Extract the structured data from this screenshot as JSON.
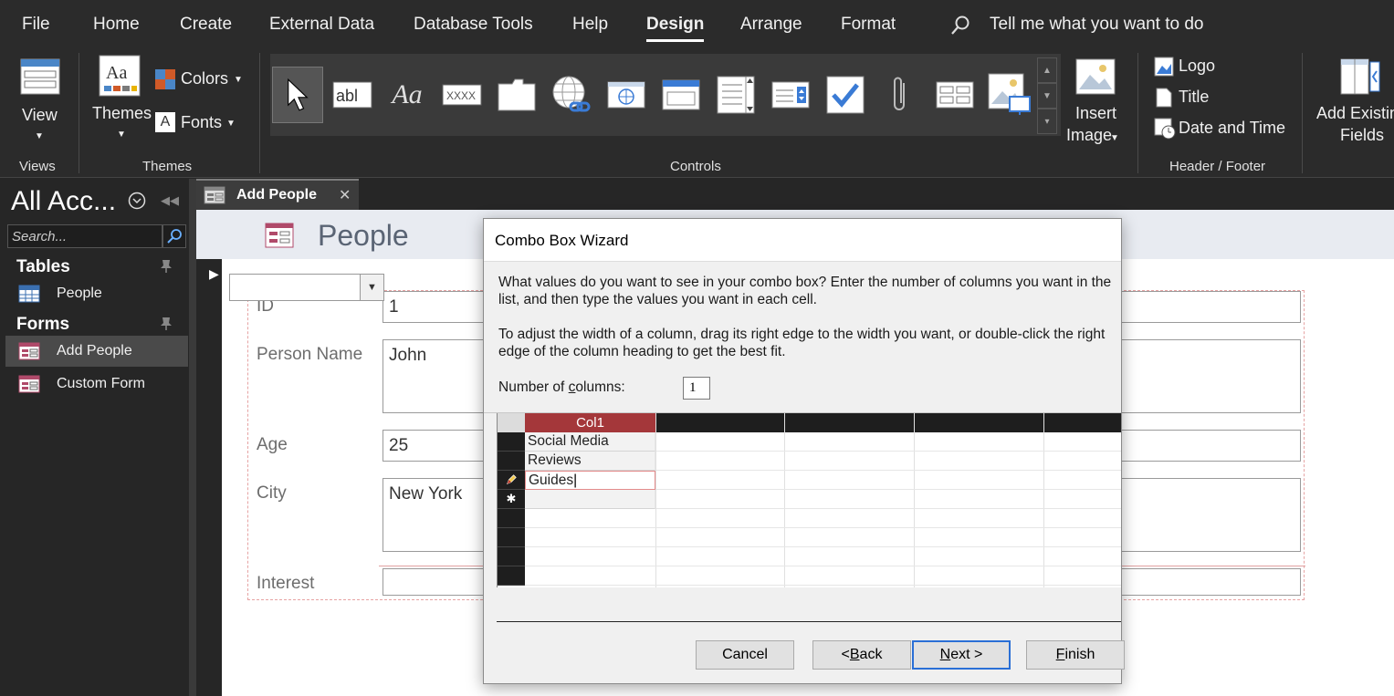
{
  "ribbon_tabs": [
    {
      "label": "File"
    },
    {
      "label": "Home"
    },
    {
      "label": "Create"
    },
    {
      "label": "External Data"
    },
    {
      "label": "Database Tools"
    },
    {
      "label": "Help"
    },
    {
      "label": "Design",
      "active": true
    },
    {
      "label": "Arrange"
    },
    {
      "label": "Format"
    }
  ],
  "tell_me": {
    "text": "Tell me what you want to do",
    "icon": "search-icon"
  },
  "ribbon": {
    "views": {
      "button": "View",
      "group": "Views"
    },
    "themes": {
      "button": "Themes",
      "colors": "Colors",
      "fonts": "Fonts",
      "group": "Themes"
    },
    "controls": {
      "group": "Controls",
      "items": [
        "select-pointer-icon",
        "text-box-icon",
        "label-icon",
        "button-icon",
        "tab-control-icon",
        "hyperlink-icon",
        "web-browser-icon",
        "navigation-control-icon",
        "option-group-icon",
        "page-break-icon",
        "combo-box-icon",
        "check-box-icon",
        "attachment-icon",
        "list-box-icon",
        "image-control-icon"
      ],
      "insert_image_line1": "Insert",
      "insert_image_line2": "Image"
    },
    "header_footer": {
      "logo": "Logo",
      "title": "Title",
      "date_time": "Date and Time",
      "group": "Header / Footer"
    },
    "tools": {
      "line1": "Add Existin",
      "line2": "Fields"
    }
  },
  "nav": {
    "title": "All Acc...",
    "search_placeholder": "Search...",
    "sections": [
      {
        "label": "Tables",
        "items": [
          {
            "label": "People",
            "icon": "table-icon"
          }
        ]
      },
      {
        "label": "Forms",
        "items": [
          {
            "label": "Add People",
            "icon": "form-icon",
            "selected": true
          },
          {
            "label": "Custom Form",
            "icon": "form-icon"
          }
        ]
      }
    ]
  },
  "doc_tab": {
    "label": "Add People"
  },
  "form": {
    "title": "People",
    "fields": [
      {
        "label": "ID",
        "value": "1"
      },
      {
        "label": "Person Name",
        "value": "John"
      },
      {
        "label": "Age",
        "value": "25"
      },
      {
        "label": "City",
        "value": "New York"
      },
      {
        "label": "Interest",
        "value": ""
      }
    ]
  },
  "dialog": {
    "title": "Combo Box Wizard",
    "para1": "What values do you want to see in your combo box? Enter the number of columns you want in the list, and then type the values you want in each cell.",
    "para2": "To adjust the width of a column, drag its right edge to the width you want, or double-click the right edge of the column heading to get the best fit.",
    "ncols_label_pre": "Number of ",
    "ncols_label_mn": "c",
    "ncols_label_post": "olumns:",
    "ncols_value": "1",
    "grid": {
      "column_header": "Col1",
      "rows": [
        "Social Media",
        "Reviews",
        "Guides"
      ]
    },
    "buttons": {
      "cancel": "Cancel",
      "back_pre": "< ",
      "back_mn": "B",
      "back_post": "ack",
      "next_mn": "N",
      "next_post": "ext >",
      "finish_mn": "F",
      "finish_post": "inish"
    }
  },
  "colors": {
    "grid_header": "#a4373a",
    "default_button_border": "#2a6fd6",
    "active_cell_border": "#e48b8b"
  }
}
